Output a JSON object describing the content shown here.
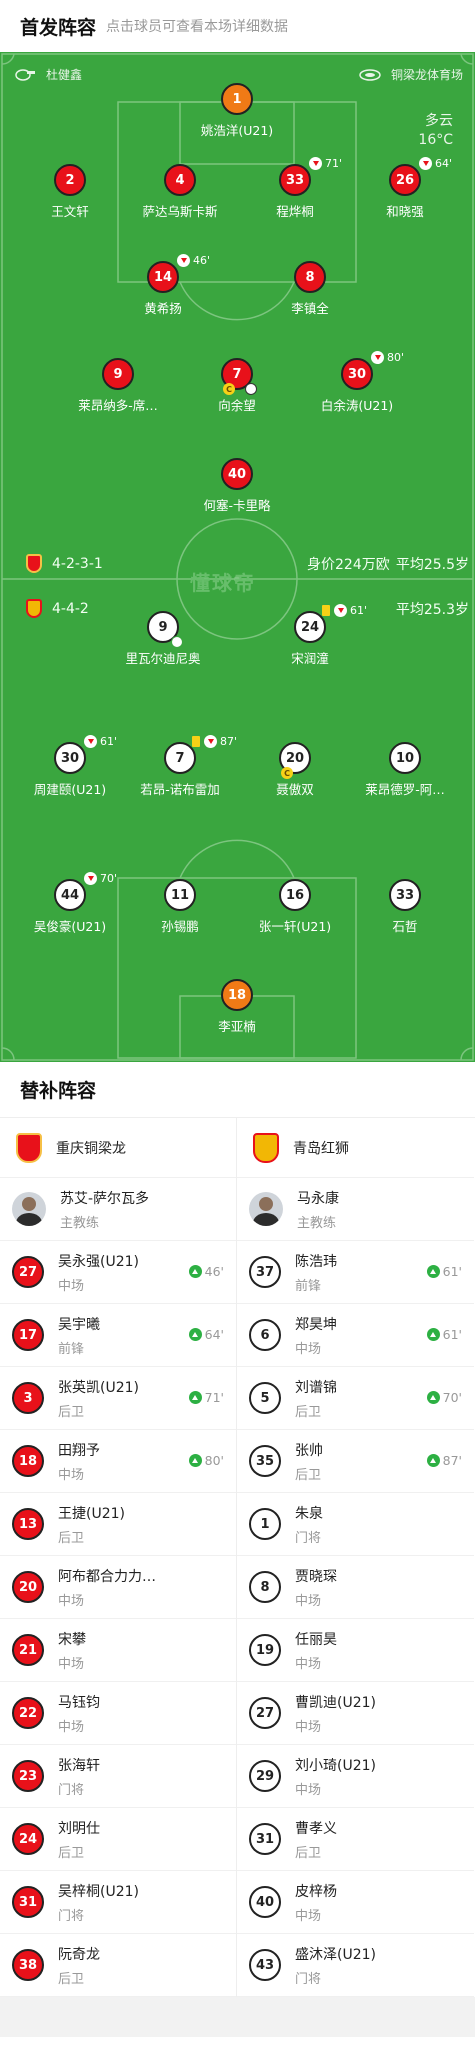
{
  "header": {
    "title": "首发阵容",
    "subtitle": "点击球员可查看本场详细数据"
  },
  "pitch": {
    "referee": "杜健鑫",
    "stadium": "铜梁龙体育场",
    "weather": "多云",
    "temperature": "16°C",
    "watermark": "懂球帝",
    "home": {
      "formation": "4-2-3-1",
      "value": "身价224万欧",
      "avg_age": "平均25.5岁",
      "color": "#e8111a"
    },
    "away": {
      "formation": "4-4-2",
      "avg_age": "平均25.3岁",
      "color": "#f2b705"
    },
    "home_players": [
      {
        "num": "1",
        "name": "姚浩洋(U21)"
      },
      {
        "num": "2",
        "name": "王文轩"
      },
      {
        "num": "4",
        "name": "萨达乌斯卡斯"
      },
      {
        "num": "33",
        "name": "程烨桐",
        "sub": "71'"
      },
      {
        "num": "26",
        "name": "和晓强",
        "sub": "64'"
      },
      {
        "num": "14",
        "name": "黄希扬",
        "sub": "46'"
      },
      {
        "num": "8",
        "name": "李镇全"
      },
      {
        "num": "9",
        "name": "莱昂纳多-席…"
      },
      {
        "num": "7",
        "name": "向余望",
        "captain": "C"
      },
      {
        "num": "30",
        "name": "白余涛(U21)",
        "sub": "80'"
      },
      {
        "num": "40",
        "name": "何塞-卡里略"
      }
    ],
    "away_players": [
      {
        "num": "9",
        "name": "里瓦尔迪尼奥"
      },
      {
        "num": "24",
        "name": "宋润潼",
        "sub": "61'"
      },
      {
        "num": "30",
        "name": "周建颐(U21)",
        "sub": "61'"
      },
      {
        "num": "7",
        "name": "若昂-诺布雷加",
        "sub": "87'"
      },
      {
        "num": "20",
        "name": "聂傲双",
        "captain": "C"
      },
      {
        "num": "10",
        "name": "莱昂德罗-阿…"
      },
      {
        "num": "44",
        "name": "吴俊豪(U21)",
        "sub": "70'"
      },
      {
        "num": "11",
        "name": "孙锡鹏"
      },
      {
        "num": "16",
        "name": "张一轩(U21)"
      },
      {
        "num": "33",
        "name": "石哲"
      },
      {
        "num": "18",
        "name": "李亚楠"
      }
    ]
  },
  "subs": {
    "title": "替补阵容",
    "home": {
      "team": "重庆铜梁龙",
      "coach": {
        "name": "苏艾-萨尔瓦多",
        "role": "主教练"
      },
      "players": [
        {
          "num": "27",
          "name": "吴永强(U21)",
          "pos": "中场",
          "time": "46'"
        },
        {
          "num": "17",
          "name": "吴宇曦",
          "pos": "前锋",
          "time": "64'"
        },
        {
          "num": "3",
          "name": "张英凯(U21)",
          "pos": "后卫",
          "time": "71'"
        },
        {
          "num": "18",
          "name": "田翔予",
          "pos": "中场",
          "time": "80'"
        },
        {
          "num": "13",
          "name": "王捷(U21)",
          "pos": "后卫"
        },
        {
          "num": "20",
          "name": "阿布都合力力…",
          "pos": "中场"
        },
        {
          "num": "21",
          "name": "宋攀",
          "pos": "中场"
        },
        {
          "num": "22",
          "name": "马钰钧",
          "pos": "中场"
        },
        {
          "num": "23",
          "name": "张海轩",
          "pos": "门将"
        },
        {
          "num": "24",
          "name": "刘明仕",
          "pos": "后卫"
        },
        {
          "num": "31",
          "name": "吴梓桐(U21)",
          "pos": "门将"
        },
        {
          "num": "38",
          "name": "阮奇龙",
          "pos": "后卫"
        }
      ]
    },
    "away": {
      "team": "青岛红狮",
      "coach": {
        "name": "马永康",
        "role": "主教练"
      },
      "players": [
        {
          "num": "37",
          "name": "陈浩玮",
          "pos": "前锋",
          "time": "61'"
        },
        {
          "num": "6",
          "name": "郑昊坤",
          "pos": "中场",
          "time": "61'"
        },
        {
          "num": "5",
          "name": "刘谱锦",
          "pos": "后卫",
          "time": "70'"
        },
        {
          "num": "35",
          "name": "张帅",
          "pos": "后卫",
          "time": "87'"
        },
        {
          "num": "1",
          "name": "朱泉",
          "pos": "门将"
        },
        {
          "num": "8",
          "name": "贾晓琛",
          "pos": "中场"
        },
        {
          "num": "19",
          "name": "任丽昊",
          "pos": "中场"
        },
        {
          "num": "27",
          "name": "曹凯迪(U21)",
          "pos": "中场"
        },
        {
          "num": "29",
          "name": "刘小琦(U21)",
          "pos": "中场"
        },
        {
          "num": "31",
          "name": "曹孝义",
          "pos": "后卫"
        },
        {
          "num": "40",
          "name": "皮梓杨",
          "pos": "中场"
        },
        {
          "num": "43",
          "name": "盛沐泽(U21)",
          "pos": "门将"
        }
      ]
    }
  }
}
